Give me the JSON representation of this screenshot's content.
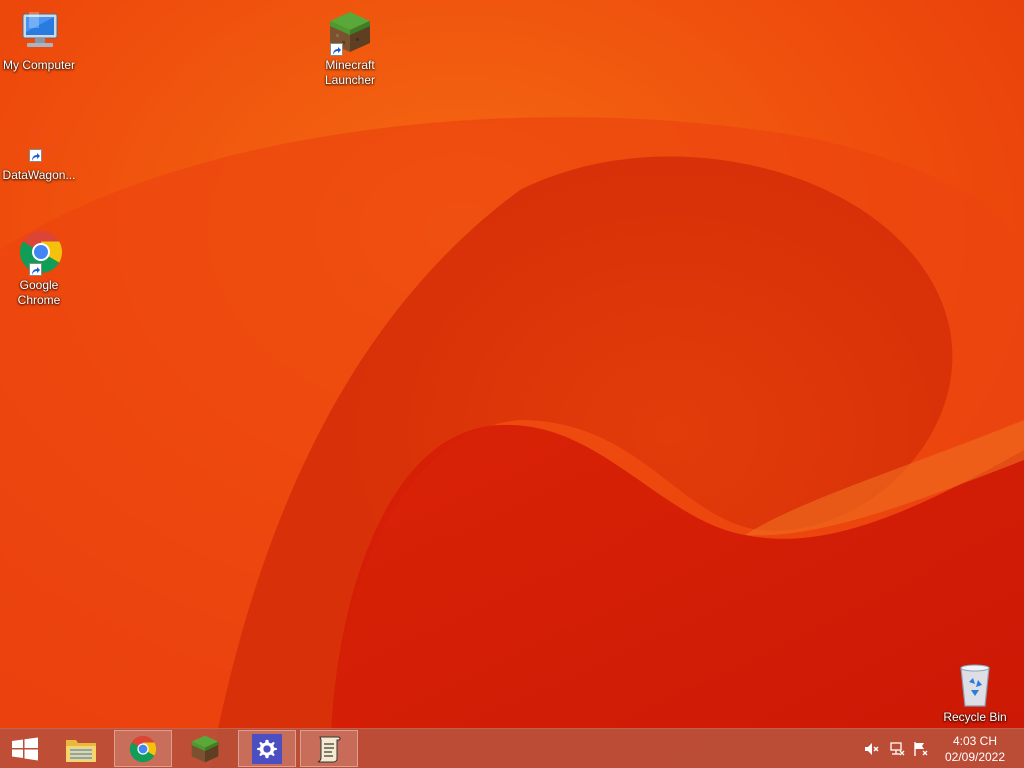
{
  "desktop": {
    "icons": [
      {
        "label": "My Computer",
        "icon": "computer-icon"
      },
      {
        "label": "DataWagon...",
        "icon": "datawagon-icon"
      },
      {
        "label": "Google Chrome",
        "icon": "chrome-icon"
      },
      {
        "label": "Minecraft Launcher",
        "icon": "minecraft-icon"
      },
      {
        "label": "Recycle Bin",
        "icon": "recycle-bin-icon"
      }
    ]
  },
  "taskbar": {
    "buttons": [
      {
        "name": "start",
        "icon": "windows-logo-icon"
      },
      {
        "name": "file-explorer",
        "icon": "folder-icon"
      },
      {
        "name": "chrome",
        "icon": "chrome-icon"
      },
      {
        "name": "minecraft",
        "icon": "minecraft-icon"
      },
      {
        "name": "settings",
        "icon": "gear-icon"
      },
      {
        "name": "script",
        "icon": "scroll-icon"
      }
    ],
    "tray": {
      "icons": [
        "speaker-muted-icon",
        "network-icon",
        "action-center-flag-icon"
      ],
      "time": "4:03 CH",
      "date": "02/09/2022"
    }
  },
  "colors": {
    "wallpaper_base": "#ee4a10",
    "taskbar": "#ba503a",
    "settings_accent": "#4b4fc2"
  }
}
